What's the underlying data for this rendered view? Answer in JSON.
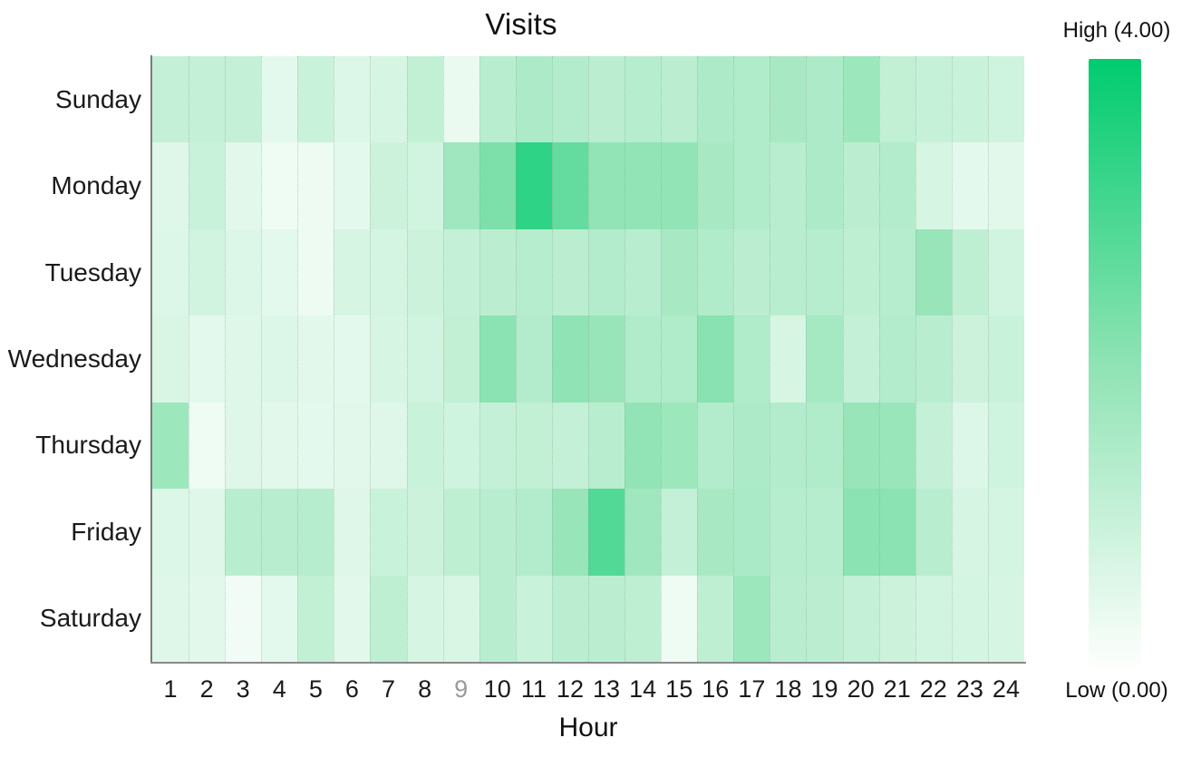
{
  "title": "Visits",
  "axes": {
    "x_title": "Hour",
    "y_title": "",
    "hour_labels": [
      "1",
      "2",
      "3",
      "4",
      "5",
      "6",
      "7",
      "8",
      "9",
      "10",
      "11",
      "12",
      "13",
      "14",
      "15",
      "16",
      "17",
      "18",
      "19",
      "20",
      "21",
      "22",
      "23",
      "24"
    ],
    "muted_hour_label": "9",
    "day_labels": [
      "Sunday",
      "Monday",
      "Tuesday",
      "Wednesday",
      "Thursday",
      "Friday",
      "Saturday"
    ]
  },
  "legend": {
    "high_label": "High (4.00)",
    "low_label": "Low (0.00)",
    "high_color": "#00CC6E",
    "low_color": "#FDFFFD",
    "orientation": "vertical"
  },
  "colors": {
    "accent": "#00CC6E",
    "axis": "#7A7A7A",
    "gridline": "#8296874d",
    "text": "#1A1A1A",
    "muted_text": "#9A9A9A",
    "background": "#FFFFFF"
  },
  "chart_data": {
    "type": "heatmap",
    "title": "Visits",
    "xlabel": "Hour",
    "ylabel": "",
    "grid": true,
    "legend_position": "right",
    "value_min": 0.0,
    "value_max": 4.0,
    "x": [
      "1",
      "2",
      "3",
      "4",
      "5",
      "6",
      "7",
      "8",
      "9",
      "10",
      "11",
      "12",
      "13",
      "14",
      "15",
      "16",
      "17",
      "18",
      "19",
      "20",
      "21",
      "22",
      "23",
      "24"
    ],
    "y": [
      "Sunday",
      "Monday",
      "Tuesday",
      "Wednesday",
      "Thursday",
      "Friday",
      "Saturday"
    ],
    "colorscale": [
      {
        "stop": 0.0,
        "color": "#FDFFFD"
      },
      {
        "stop": 0.5,
        "color": "#8FE3B4"
      },
      {
        "stop": 1.0,
        "color": "#00CC6E"
      }
    ],
    "values": [
      [
        1.05,
        1.05,
        1.05,
        0.45,
        0.95,
        0.6,
        0.7,
        1.1,
        0.35,
        1.25,
        1.45,
        1.35,
        1.2,
        1.3,
        1.2,
        1.45,
        1.4,
        1.55,
        1.45,
        1.75,
        1.1,
        1.0,
        0.95,
        0.85
      ],
      [
        0.55,
        0.95,
        0.5,
        0.25,
        0.3,
        0.45,
        0.9,
        0.8,
        1.7,
        2.25,
        3.35,
        2.6,
        1.95,
        1.95,
        1.95,
        1.55,
        1.4,
        1.25,
        1.45,
        1.2,
        1.35,
        0.7,
        0.45,
        0.5
      ],
      [
        0.6,
        0.8,
        0.6,
        0.45,
        0.3,
        0.7,
        0.75,
        0.9,
        1.05,
        1.2,
        1.3,
        1.2,
        1.35,
        1.25,
        1.55,
        1.4,
        1.2,
        1.25,
        1.3,
        1.15,
        1.3,
        1.85,
        1.15,
        0.8
      ],
      [
        0.65,
        0.45,
        0.55,
        0.6,
        0.5,
        0.45,
        0.7,
        0.8,
        1.1,
        2.05,
        1.35,
        2.0,
        1.85,
        1.4,
        1.4,
        2.1,
        1.4,
        0.7,
        1.6,
        1.05,
        1.35,
        1.25,
        0.9,
        0.95
      ],
      [
        1.75,
        0.25,
        0.55,
        0.5,
        0.45,
        0.5,
        0.55,
        0.95,
        0.85,
        1.05,
        1.1,
        1.05,
        1.25,
        1.95,
        1.75,
        1.35,
        1.45,
        1.35,
        1.4,
        1.85,
        1.8,
        1.05,
        0.6,
        0.85
      ],
      [
        0.6,
        0.55,
        1.25,
        1.25,
        1.3,
        0.55,
        0.95,
        0.9,
        1.15,
        1.25,
        1.35,
        1.85,
        2.85,
        1.7,
        1.05,
        1.55,
        1.5,
        1.3,
        1.3,
        2.05,
        2.05,
        1.25,
        0.7,
        0.75
      ],
      [
        0.55,
        0.5,
        0.2,
        0.45,
        1.1,
        0.5,
        1.15,
        0.7,
        0.65,
        1.25,
        0.95,
        1.2,
        1.2,
        1.15,
        0.25,
        1.15,
        1.75,
        1.25,
        1.2,
        1.05,
        0.9,
        0.8,
        0.75,
        0.7
      ]
    ]
  }
}
